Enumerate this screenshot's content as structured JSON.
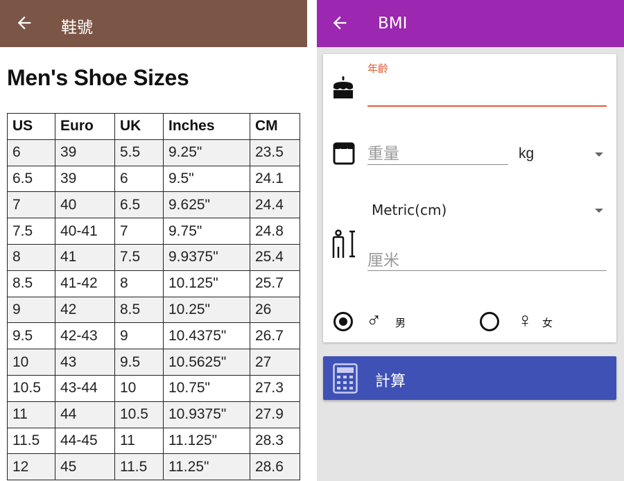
{
  "shoe_screen": {
    "title": "鞋號",
    "heading": "Men's Shoe Sizes",
    "columns": [
      "US",
      "Euro",
      "UK",
      "Inches",
      "CM"
    ],
    "rows": [
      [
        "6",
        "39",
        "5.5",
        "9.25\"",
        "23.5"
      ],
      [
        "6.5",
        "39",
        "6",
        "9.5\"",
        "24.1"
      ],
      [
        "7",
        "40",
        "6.5",
        "9.625\"",
        "24.4"
      ],
      [
        "7.5",
        "40-41",
        "7",
        "9.75\"",
        "24.8"
      ],
      [
        "8",
        "41",
        "7.5",
        "9.9375\"",
        "25.4"
      ],
      [
        "8.5",
        "41-42",
        "8",
        "10.125\"",
        "25.7"
      ],
      [
        "9",
        "42",
        "8.5",
        "10.25\"",
        "26"
      ],
      [
        "9.5",
        "42-43",
        "9",
        "10.4375\"",
        "26.7"
      ],
      [
        "10",
        "43",
        "9.5",
        "10.5625\"",
        "27"
      ],
      [
        "10.5",
        "43-44",
        "10",
        "10.75\"",
        "27.3"
      ],
      [
        "11",
        "44",
        "10.5",
        "10.9375\"",
        "27.9"
      ],
      [
        "11.5",
        "44-45",
        "11",
        "11.125\"",
        "28.3"
      ],
      [
        "12",
        "45",
        "11.5",
        "11.25\"",
        "28.6"
      ]
    ],
    "header_color": "#7b5546"
  },
  "bmi_screen": {
    "title": "BMI",
    "header_color": "#9c27b0",
    "age": {
      "label": "年齡",
      "value": "",
      "accent": "#e45b35"
    },
    "weight": {
      "placeholder": "重量",
      "unit": "kg"
    },
    "height_unit": "Metric(cm)",
    "height": {
      "placeholder": "厘米"
    },
    "gender": {
      "male": {
        "symbol": "♂",
        "label": "男",
        "selected": true
      },
      "female": {
        "symbol": "♀",
        "label": "女",
        "selected": false
      }
    },
    "calculate_label": "計算",
    "button_color": "#3f51b5"
  },
  "icons": {
    "back": "arrow-left-icon",
    "age": "birthday-cake-icon",
    "weight": "scale-icon",
    "height": "person-height-icon",
    "calculate": "calculator-icon"
  }
}
